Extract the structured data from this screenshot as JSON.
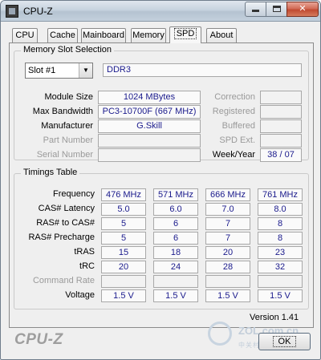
{
  "window": {
    "title": "CPU-Z"
  },
  "tabs": [
    {
      "label": "CPU"
    },
    {
      "label": "Cache"
    },
    {
      "label": "Mainboard"
    },
    {
      "label": "Memory"
    },
    {
      "label": "SPD"
    },
    {
      "label": "About"
    }
  ],
  "active_tab": "SPD",
  "slot": {
    "group_title": "Memory Slot Selection",
    "selected": "Slot #1",
    "type": "DDR3",
    "labels": {
      "module_size": "Module Size",
      "max_bandwidth": "Max Bandwidth",
      "manufacturer": "Manufacturer",
      "part_number": "Part Number",
      "serial_number": "Serial Number",
      "correction": "Correction",
      "registered": "Registered",
      "buffered": "Buffered",
      "spd_ext": "SPD Ext.",
      "week_year": "Week/Year"
    },
    "values": {
      "module_size": "1024 MBytes",
      "max_bandwidth": "PC3-10700F (667 MHz)",
      "manufacturer": "G.Skill",
      "part_number": "",
      "serial_number": "",
      "correction": "",
      "registered": "",
      "buffered": "",
      "spd_ext": "",
      "week_year": "38 / 07"
    }
  },
  "timings": {
    "group_title": "Timings Table",
    "rows": [
      {
        "label": "Frequency",
        "values": [
          "476 MHz",
          "571 MHz",
          "666 MHz",
          "761 MHz"
        ],
        "dim": false
      },
      {
        "label": "CAS# Latency",
        "values": [
          "5.0",
          "6.0",
          "7.0",
          "8.0"
        ],
        "dim": false
      },
      {
        "label": "RAS# to CAS#",
        "values": [
          "5",
          "6",
          "7",
          "8"
        ],
        "dim": false
      },
      {
        "label": "RAS# Precharge",
        "values": [
          "5",
          "6",
          "7",
          "8"
        ],
        "dim": false
      },
      {
        "label": "tRAS",
        "values": [
          "15",
          "18",
          "20",
          "23"
        ],
        "dim": false
      },
      {
        "label": "tRC",
        "values": [
          "20",
          "24",
          "28",
          "32"
        ],
        "dim": false
      },
      {
        "label": "Command Rate",
        "values": [
          "",
          "",
          "",
          ""
        ],
        "dim": true
      },
      {
        "label": "Voltage",
        "values": [
          "1.5 V",
          "1.5 V",
          "1.5 V",
          "1.5 V"
        ],
        "dim": false
      }
    ]
  },
  "footer": {
    "version": "Version 1.41",
    "brand": "CPU-Z",
    "ok_label": "OK"
  },
  "watermark": {
    "text": "ZOL.com.cn",
    "sub": "中关村在线"
  },
  "colors": {
    "value_text": "#1a1a8c",
    "dim_label": "#9a9a9a",
    "close_button": "#c04a31"
  }
}
